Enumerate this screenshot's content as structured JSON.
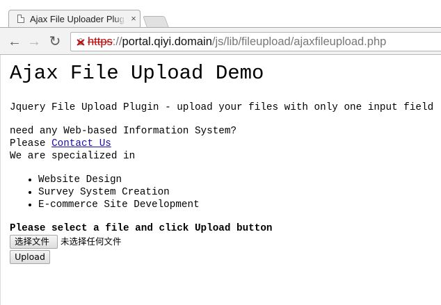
{
  "browser": {
    "tab_title": "Ajax File Uploader Plugin",
    "tab_close": "×",
    "url_scheme": "https",
    "url_sep": "://",
    "url_host": "portal.qiyi.domain",
    "url_path": "/js/lib/fileupload/ajaxfileupload.php",
    "back_glyph": "←",
    "forward_glyph": "→",
    "reload_glyph": "↻"
  },
  "page": {
    "heading": "Ajax File Upload Demo",
    "description": "Jquery File Upload Plugin - upload your files with only one input field",
    "need_line": "need any Web-based Information System?",
    "please_prefix": "Please ",
    "contact_link": "Contact Us",
    "specialized": "We are specialized in",
    "services": [
      "Website Design",
      "Survey System Creation",
      "E-commerce Site Development"
    ],
    "prompt": "Please select a file and click Upload button",
    "choose_file_label": "选择文件",
    "no_file_text": "未选择任何文件",
    "upload_label": "Upload"
  }
}
